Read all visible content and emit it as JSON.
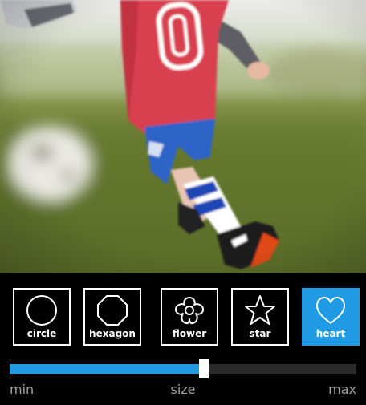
{
  "photo": {
    "jersey_number": "0"
  },
  "shapes": {
    "items": [
      {
        "id": "circle",
        "label": "circle",
        "icon": "circle-icon"
      },
      {
        "id": "hexagon",
        "label": "hexagon",
        "icon": "octagon-icon"
      },
      {
        "id": "flower",
        "label": "flower",
        "icon": "flower-icon"
      },
      {
        "id": "star",
        "label": "star",
        "icon": "star-icon"
      },
      {
        "id": "heart",
        "label": "heart",
        "icon": "heart-icon"
      }
    ],
    "selected": "heart"
  },
  "slider": {
    "value_fraction": 0.56,
    "min_label": "min",
    "title_label": "size",
    "max_label": "max"
  },
  "colors": {
    "accent": "#1e9be4",
    "background": "#000000",
    "track": "#2a2a2a",
    "label": "#a0a0a0"
  }
}
